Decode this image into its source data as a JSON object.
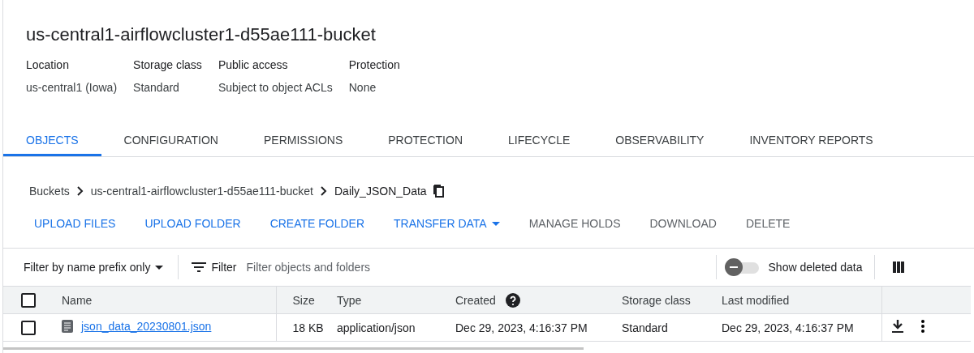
{
  "bucket": {
    "title": "us-central1-airflowcluster1-d55ae111-bucket",
    "details": [
      {
        "label": "Location",
        "value": "us-central1 (Iowa)"
      },
      {
        "label": "Storage class",
        "value": "Standard"
      },
      {
        "label": "Public access",
        "value": "Subject to object ACLs"
      },
      {
        "label": "Protection",
        "value": "None"
      }
    ]
  },
  "tabs": [
    {
      "label": "OBJECTS",
      "selected": true
    },
    {
      "label": "CONFIGURATION",
      "selected": false
    },
    {
      "label": "PERMISSIONS",
      "selected": false
    },
    {
      "label": "PROTECTION",
      "selected": false
    },
    {
      "label": "LIFECYCLE",
      "selected": false
    },
    {
      "label": "OBSERVABILITY",
      "selected": false
    },
    {
      "label": "INVENTORY REPORTS",
      "selected": false
    }
  ],
  "breadcrumb": [
    "Buckets",
    "us-central1-airflowcluster1-d55ae111-bucket",
    "Daily_JSON_Data"
  ],
  "actions": [
    {
      "label": "UPLOAD FILES",
      "disabled": false,
      "kind": "plain"
    },
    {
      "label": "UPLOAD FOLDER",
      "disabled": false,
      "kind": "plain"
    },
    {
      "label": "CREATE FOLDER",
      "disabled": false,
      "kind": "plain"
    },
    {
      "label": "TRANSFER DATA",
      "disabled": false,
      "kind": "menu"
    },
    {
      "label": "MANAGE HOLDS",
      "disabled": true,
      "kind": "plain"
    },
    {
      "label": "DOWNLOAD",
      "disabled": true,
      "kind": "plain"
    },
    {
      "label": "DELETE",
      "disabled": true,
      "kind": "plain"
    }
  ],
  "filter_bar": {
    "mode": "Filter by name prefix only",
    "filter_label": "Filter",
    "placeholder": "Filter objects and folders",
    "show_deleted": {
      "label": "Show deleted data",
      "on": false
    }
  },
  "table": {
    "select_all_checked": false,
    "columns": [
      "Name",
      "Size",
      "Type",
      "Created",
      "Storage class",
      "Last modified"
    ],
    "rows": [
      {
        "checked": false,
        "name": "json_data_20230801.json",
        "size": "18 KB",
        "type": "application/json",
        "created": "Dec 29, 2023, 4:16:37 PM",
        "storage_class": "Standard",
        "last_modified": "Dec 29, 2023, 4:16:37 PM"
      }
    ]
  }
}
